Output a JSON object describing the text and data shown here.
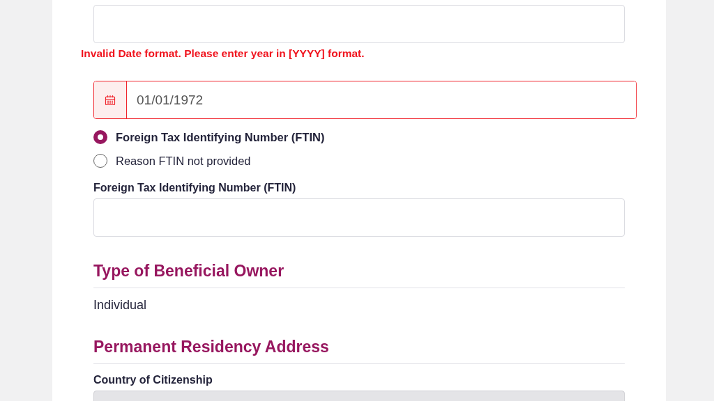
{
  "date_error": "Invalid Date format. Please enter year in [YYYY] format.",
  "date_field": {
    "value": "01/01/1972",
    "invalid": true
  },
  "ftin_options": [
    {
      "label": "Foreign Tax Identifying Number (FTIN)",
      "selected": true
    },
    {
      "label": "Reason FTIN not provided",
      "selected": false
    }
  ],
  "ftin_field": {
    "label": "Foreign Tax Identifying Number (FTIN)"
  },
  "beneficial_owner": {
    "heading": "Type of Beneficial Owner",
    "value": "Individual"
  },
  "residency": {
    "heading": "Permanent Residency Address",
    "citizenship_label": "Country of Citizenship",
    "citizenship_disabled": true
  }
}
